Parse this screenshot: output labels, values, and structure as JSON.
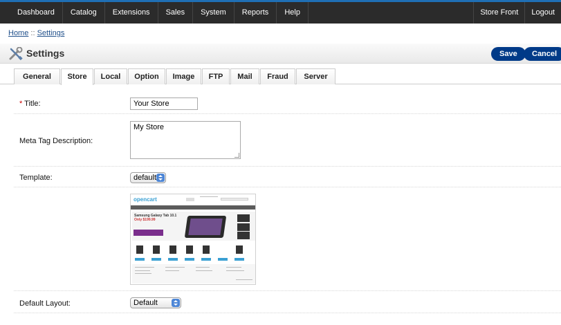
{
  "topnav": {
    "left": [
      "Dashboard",
      "Catalog",
      "Extensions",
      "Sales",
      "System",
      "Reports",
      "Help"
    ],
    "right": [
      "Store Front",
      "Logout"
    ]
  },
  "breadcrumb": {
    "home": "Home",
    "separator": "::",
    "current": "Settings"
  },
  "heading": {
    "title": "Settings",
    "save": "Save",
    "cancel": "Cancel"
  },
  "tabs": [
    "General",
    "Store",
    "Local",
    "Option",
    "Image",
    "FTP",
    "Mail",
    "Fraud",
    "Server"
  ],
  "active_tab": "Store",
  "form": {
    "title": {
      "required": "*",
      "label": " Title:",
      "value": "Your Store"
    },
    "meta": {
      "label": "Meta Tag Description:",
      "value": "My Store"
    },
    "template": {
      "label": "Template:",
      "value": "default"
    },
    "preview": {
      "logo": "opencart",
      "banner_text": "Samsung Galaxy Tab 10.1",
      "banner_price": "Only $199.99"
    },
    "layout": {
      "label": "Default Layout:",
      "value": "Default"
    }
  },
  "colors": {
    "accent_bar": "#1f6fb5",
    "button": "#003a88",
    "nav_bg": "#2b2b2b",
    "required": "#cc0000"
  },
  "icons": {
    "heading": "tools-icon",
    "select": "select-arrows-icon"
  }
}
